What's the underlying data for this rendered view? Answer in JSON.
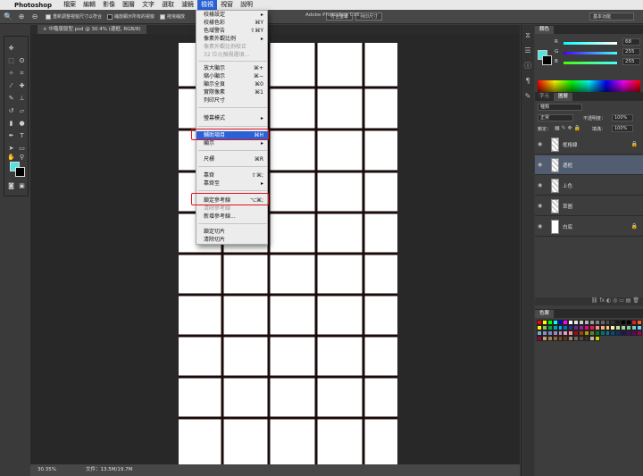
{
  "menubar": {
    "apple": "",
    "app": "Photoshop",
    "items": [
      "檔案",
      "編輯",
      "影像",
      "圖層",
      "文字",
      "選取",
      "濾鏡",
      "檢視",
      "視窗",
      "說明"
    ],
    "active_index": 7
  },
  "options": {
    "checkboxes": [
      {
        "label": "重新調整視窗尺寸以符合",
        "checked": true
      },
      {
        "label": "縮放顯示所有的視窗",
        "checked": false
      },
      {
        "label": "拖曳縮放",
        "checked": true
      }
    ],
    "buttons": [
      "符合螢幕",
      "列印尺寸"
    ],
    "window_title": "Adobe Photoshop CS6",
    "workspace": "基本功能"
  },
  "document_tab": "中階版版型.psd @ 30.4% (邊框, RGB/8)",
  "status": {
    "zoom": "30.35%",
    "doc": "文件：13.5M/19.7M"
  },
  "view_menu": {
    "items": [
      {
        "label": "校樣設定",
        "shortcut": "▸",
        "disabled": false
      },
      {
        "label": "校樣色彩",
        "shortcut": "⌘Y",
        "disabled": false
      },
      {
        "label": "色域警告",
        "shortcut": "⇧⌘Y",
        "disabled": false
      },
      {
        "label": "像素外觀比例",
        "shortcut": "▸",
        "disabled": false
      },
      {
        "label": "像素外觀比例校正",
        "shortcut": "",
        "disabled": true
      },
      {
        "label": "32 位元預視選項...",
        "shortcut": "",
        "disabled": true
      },
      {
        "label": "放大顯示",
        "shortcut": "⌘+",
        "disabled": false
      },
      {
        "label": "縮小顯示",
        "shortcut": "⌘−",
        "disabled": false
      },
      {
        "label": "顯示全頁",
        "shortcut": "⌘0",
        "disabled": false
      },
      {
        "label": "實際像素",
        "shortcut": "⌘1",
        "disabled": false
      },
      {
        "label": "列印尺寸",
        "shortcut": "",
        "disabled": false
      },
      {
        "label": "螢幕模式",
        "shortcut": "▸",
        "disabled": false
      },
      {
        "label": "輔助項目",
        "shortcut": "⌘H",
        "disabled": false
      },
      {
        "label": "顯示",
        "shortcut": "▸",
        "disabled": false
      },
      {
        "label": "尺標",
        "shortcut": "⌘R",
        "disabled": false
      },
      {
        "label": "靠齊",
        "shortcut": "⇧⌘;",
        "disabled": false
      },
      {
        "label": "靠齊至",
        "shortcut": "▸",
        "disabled": false
      },
      {
        "label": "鎖定參考線",
        "shortcut": "⌥⌘;",
        "disabled": false
      },
      {
        "label": "清除參考線",
        "shortcut": "",
        "disabled": true
      },
      {
        "label": "新增參考線...",
        "shortcut": "",
        "disabled": false
      },
      {
        "label": "鎖定切片",
        "shortcut": "",
        "disabled": false
      },
      {
        "label": "清除切片",
        "shortcut": "",
        "disabled": false
      }
    ],
    "highlighted": "輔助項目",
    "annotated": [
      "輔助項目",
      "鎖定參考線"
    ]
  },
  "panels": {
    "color_tab": "顏色",
    "color": {
      "channels": [
        {
          "label": "R",
          "value": "68"
        },
        {
          "label": "G",
          "value": "255"
        },
        {
          "label": "B",
          "value": "255"
        }
      ],
      "foreground": "#44FFFF",
      "background": "#000000"
    },
    "layers_tabs": [
      "字元",
      "圖層"
    ],
    "layers_filter": "種類",
    "blend_mode": "正常",
    "opacity_label": "不透明度：",
    "opacity": "100%",
    "lock_label": "鎖定：",
    "fill_label": "填滿：",
    "fill": "100%",
    "layers": [
      {
        "name": "框格線",
        "selected": false,
        "locked": true,
        "thumb": "checker"
      },
      {
        "name": "邊框",
        "selected": true,
        "locked": false,
        "thumb": "checker"
      },
      {
        "name": "上色",
        "selected": false,
        "locked": false,
        "thumb": "checker"
      },
      {
        "name": "草圖",
        "selected": false,
        "locked": false,
        "thumb": "checker"
      },
      {
        "name": "白底",
        "selected": false,
        "locked": true,
        "thumb": "white"
      }
    ],
    "swatches_tab": "色票"
  },
  "colors": {
    "menu_highlight": "#2A62D6",
    "annotation_red": "#E0101A",
    "grid_border": "#1A0A0A"
  }
}
